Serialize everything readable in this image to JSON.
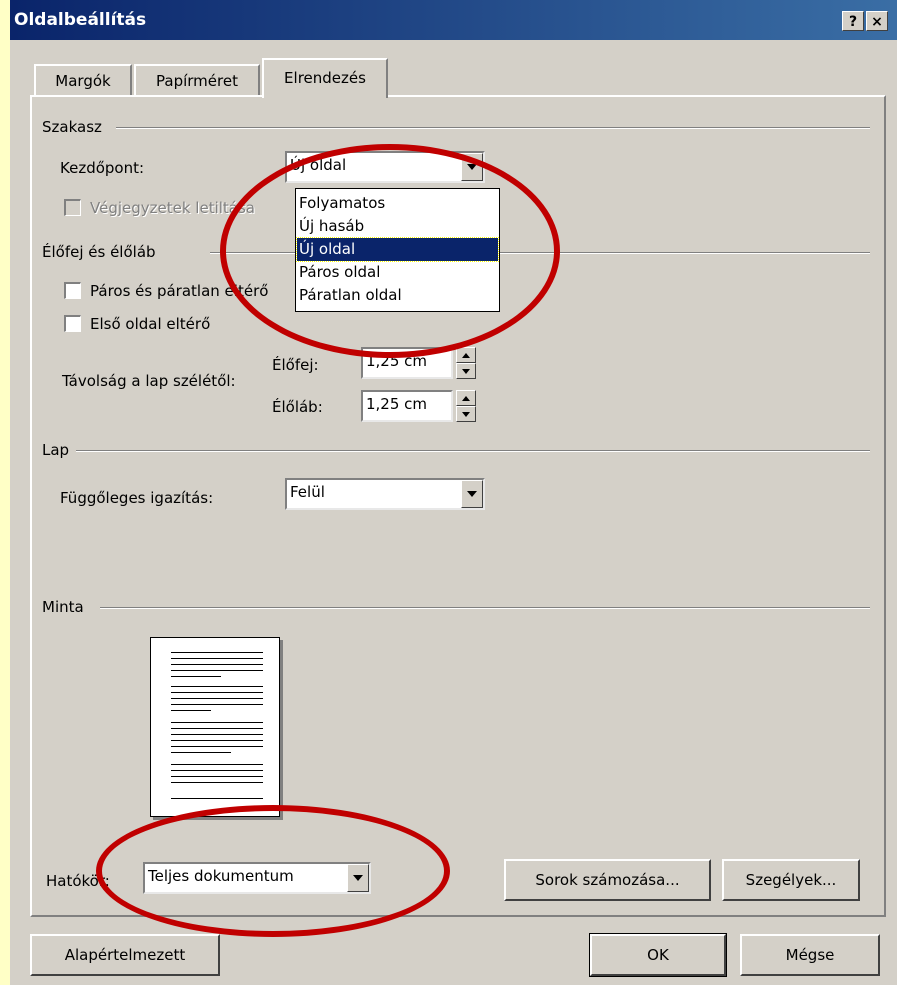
{
  "window": {
    "title": "Oldalbeállítás",
    "help_button": "?",
    "close_button": "×"
  },
  "tabs": [
    {
      "label": "Margók",
      "active": false
    },
    {
      "label": "Papírméret",
      "active": false
    },
    {
      "label": "Elrendezés",
      "active": true
    }
  ],
  "section": {
    "group_label": "Szakasz",
    "start_label": "Kezdőpont:",
    "start_value": "Új oldal",
    "endnotes_label": "Végjegyzetek letiltása",
    "dropdown_options": [
      "Folyamatos",
      "Új hasáb",
      "Új oldal",
      "Páros oldal",
      "Páratlan oldal"
    ],
    "selected_option": "Új oldal"
  },
  "header_footer": {
    "group_label": "Élőfej és élőláb",
    "odd_even_label": "Páros és páratlan eltérő",
    "first_page_label": "Első oldal eltérő",
    "distance_label": "Távolság a lap szélétől:",
    "header_label": "Élőfej:",
    "header_value": "1,25 cm",
    "footer_label": "Élőláb:",
    "footer_value": "1,25 cm"
  },
  "page": {
    "group_label": "Lap",
    "vertical_align_label": "Függőleges igazítás:",
    "vertical_align_value": "Felül"
  },
  "preview": {
    "group_label": "Minta"
  },
  "apply": {
    "label": "Hatókör:",
    "value": "Teljes dokumentum"
  },
  "buttons": {
    "line_numbers": "Sorok számozása...",
    "borders": "Szegélyek...",
    "default": "Alapértelmezett",
    "ok": "OK",
    "cancel": "Mégse"
  },
  "colors": {
    "title_bar": "#0a246a",
    "dialog_bg": "#d4d0c8",
    "desktop_bg": "#ffffc6",
    "highlight": "#0a246a",
    "annotation": "#c00000"
  }
}
